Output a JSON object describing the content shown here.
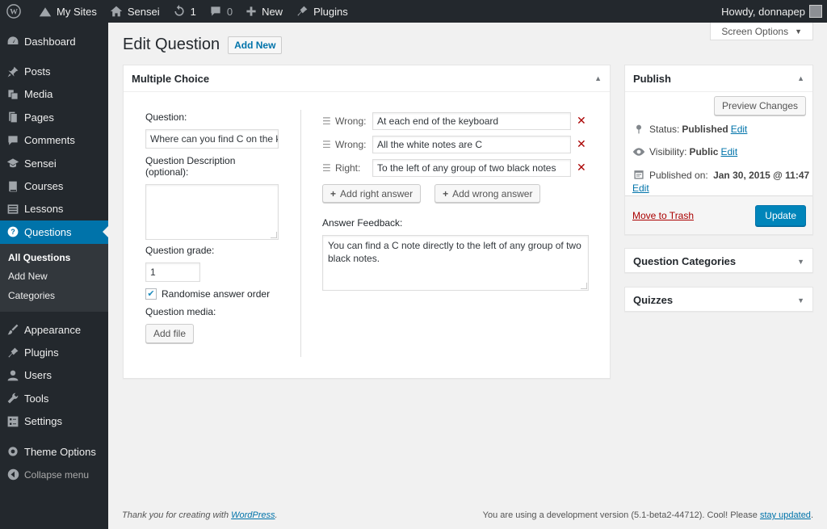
{
  "adminbar": {
    "my_sites": "My Sites",
    "site_name": "Sensei",
    "updates_count": "1",
    "comments_count": "0",
    "new_label": "New",
    "plugins_label": "Plugins",
    "howdy": "Howdy, donnapep"
  },
  "sidebar": {
    "items_top": [
      {
        "label": "Dashboard",
        "icon": "dashboard-icon"
      }
    ],
    "items_main": [
      {
        "label": "Posts",
        "icon": "pin-icon"
      },
      {
        "label": "Media",
        "icon": "media-icon"
      },
      {
        "label": "Pages",
        "icon": "page-icon"
      },
      {
        "label": "Comments",
        "icon": "comment-icon"
      },
      {
        "label": "Sensei",
        "icon": "graduation-cap-icon"
      },
      {
        "label": "Courses",
        "icon": "book-icon"
      },
      {
        "label": "Lessons",
        "icon": "list-icon"
      }
    ],
    "current": {
      "label": "Questions",
      "icon": "question-icon"
    },
    "submenu": [
      "All Questions",
      "Add New",
      "Categories"
    ],
    "items_lower": [
      {
        "label": "Appearance",
        "icon": "brush-icon"
      },
      {
        "label": "Plugins",
        "icon": "plug-icon"
      },
      {
        "label": "Users",
        "icon": "user-icon"
      },
      {
        "label": "Tools",
        "icon": "wrench-icon"
      },
      {
        "label": "Settings",
        "icon": "settings-icon"
      }
    ],
    "theme_options": "Theme Options",
    "collapse": "Collapse menu"
  },
  "header": {
    "screen_options": "Screen Options",
    "title": "Edit Question",
    "add_new": "Add New"
  },
  "question_box": {
    "title": "Multiple Choice",
    "question_label": "Question:",
    "question_value": "Where can you find C on the keyboard?",
    "description_label": "Question Description (optional):",
    "description_value": "",
    "grade_label": "Question grade:",
    "grade_value": "1",
    "randomise_label": "Randomise answer order",
    "randomise_checked": true,
    "media_label": "Question media:",
    "add_file": "Add file",
    "answers": [
      {
        "type": "Wrong:",
        "text": "At each end of the keyboard"
      },
      {
        "type": "Wrong:",
        "text": "All the white notes are C"
      },
      {
        "type": "Right:",
        "text": "To the left of any group of two black notes"
      }
    ],
    "add_right": "Add right answer",
    "add_wrong": "Add wrong answer",
    "feedback_label": "Answer Feedback:",
    "feedback_value": "You can find a C note directly to the left of any group of two black notes."
  },
  "publish": {
    "title": "Publish",
    "preview": "Preview Changes",
    "status_label": "Status:",
    "status_value": "Published",
    "visibility_label": "Visibility:",
    "visibility_value": "Public",
    "published_label": "Published on:",
    "published_value": "Jan 30, 2015 @ 11:47",
    "edit": "Edit",
    "trash": "Move to Trash",
    "update": "Update"
  },
  "categories_box": {
    "title": "Question Categories"
  },
  "quizzes_box": {
    "title": "Quizzes"
  },
  "footer": {
    "thanks_prefix": "Thank you for creating with ",
    "wordpress": "WordPress",
    "thanks_suffix": ".",
    "version_text": "You are using a development version (5.1-beta2-44712). Cool! Please ",
    "stay_updated": "stay updated",
    "version_suffix": "."
  },
  "colors": {
    "accent": "#0073aa",
    "sidebar_bg": "#23282d",
    "button_primary": "#0085ba",
    "delete": "#aa0000"
  }
}
